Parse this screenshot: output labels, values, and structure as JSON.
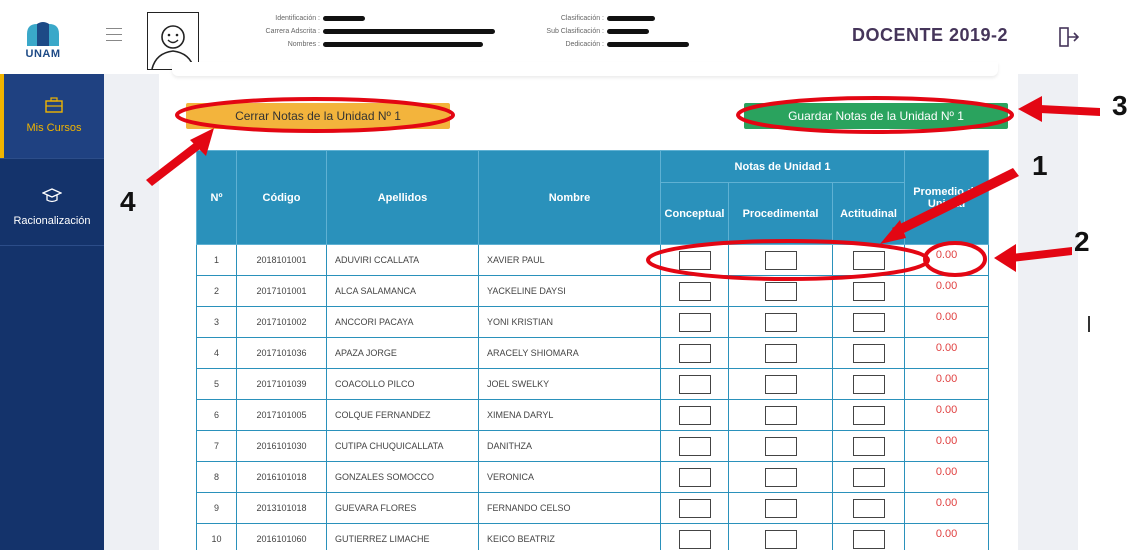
{
  "header": {
    "logo_text": "UNAM",
    "info_left": [
      {
        "label": "Identificación :"
      },
      {
        "label": "Carrera Adscrita :"
      },
      {
        "label": "Nombres :"
      }
    ],
    "info_right": [
      {
        "label": "Clasificación :"
      },
      {
        "label": "Sub Clasificación :"
      },
      {
        "label": "Dedicación :"
      }
    ],
    "title": "DOCENTE 2019-2",
    "exit_icon": "logout-icon"
  },
  "sidebar": {
    "items": [
      {
        "label": "Mis Cursos",
        "icon": "briefcase-icon"
      },
      {
        "label": "Racionalización",
        "icon": "graduation-cap-icon"
      }
    ]
  },
  "buttons": {
    "cerrar": "Cerrar Notas de la Unidad Nº 1",
    "guardar": "Guardar Notas de la Unidad Nº 1"
  },
  "table": {
    "headers": {
      "no": "Nº",
      "codigo": "Código",
      "apellidos": "Apellidos",
      "nombre": "Nombre",
      "group": "Notas de Unidad 1",
      "conceptual": "Conceptual",
      "procedimental": "Procedimental",
      "actitudinal": "Actitudinal",
      "promedio": "Promedio de Unidad"
    },
    "rows": [
      {
        "no": "1",
        "codigo": "2018101001",
        "apellidos": "ADUVIRI CCALLATA",
        "nombre": "XAVIER PAUL",
        "promedio": "0.00"
      },
      {
        "no": "2",
        "codigo": "2017101001",
        "apellidos": "ALCA SALAMANCA",
        "nombre": "YACKELINE DAYSI",
        "promedio": "0.00"
      },
      {
        "no": "3",
        "codigo": "2017101002",
        "apellidos": "ANCCORI PACAYA",
        "nombre": "YONI KRISTIAN",
        "promedio": "0.00"
      },
      {
        "no": "4",
        "codigo": "2017101036",
        "apellidos": "APAZA JORGE",
        "nombre": "ARACELY SHIOMARA",
        "promedio": "0.00"
      },
      {
        "no": "5",
        "codigo": "2017101039",
        "apellidos": "COACOLLO PILCO",
        "nombre": "JOEL SWELKY",
        "promedio": "0.00"
      },
      {
        "no": "6",
        "codigo": "2017101005",
        "apellidos": "COLQUE FERNANDEZ",
        "nombre": "XIMENA DARYL",
        "promedio": "0.00"
      },
      {
        "no": "7",
        "codigo": "2016101030",
        "apellidos": "CUTIPA CHUQUICALLATA",
        "nombre": "DANITHZA",
        "promedio": "0.00"
      },
      {
        "no": "8",
        "codigo": "2016101018",
        "apellidos": "GONZALES SOMOCCO",
        "nombre": "VERONICA",
        "promedio": "0.00"
      },
      {
        "no": "9",
        "codigo": "2013101018",
        "apellidos": "GUEVARA FLORES",
        "nombre": "FERNANDO CELSO",
        "promedio": "0.00"
      },
      {
        "no": "10",
        "codigo": "2016101060",
        "apellidos": "GUTIERREZ LIMACHE",
        "nombre": "KEICO BEATRIZ",
        "promedio": "0.00"
      }
    ]
  },
  "annotations": {
    "n1": "1",
    "n2": "2",
    "n3": "3",
    "n4": "4",
    "color": "#e30613"
  },
  "colors": {
    "sidebar": "#14336b",
    "table_header": "#2a91bb",
    "btn_cerrar": "#f3b43c",
    "btn_guardar": "#2aa35e",
    "title": "#45355a"
  }
}
